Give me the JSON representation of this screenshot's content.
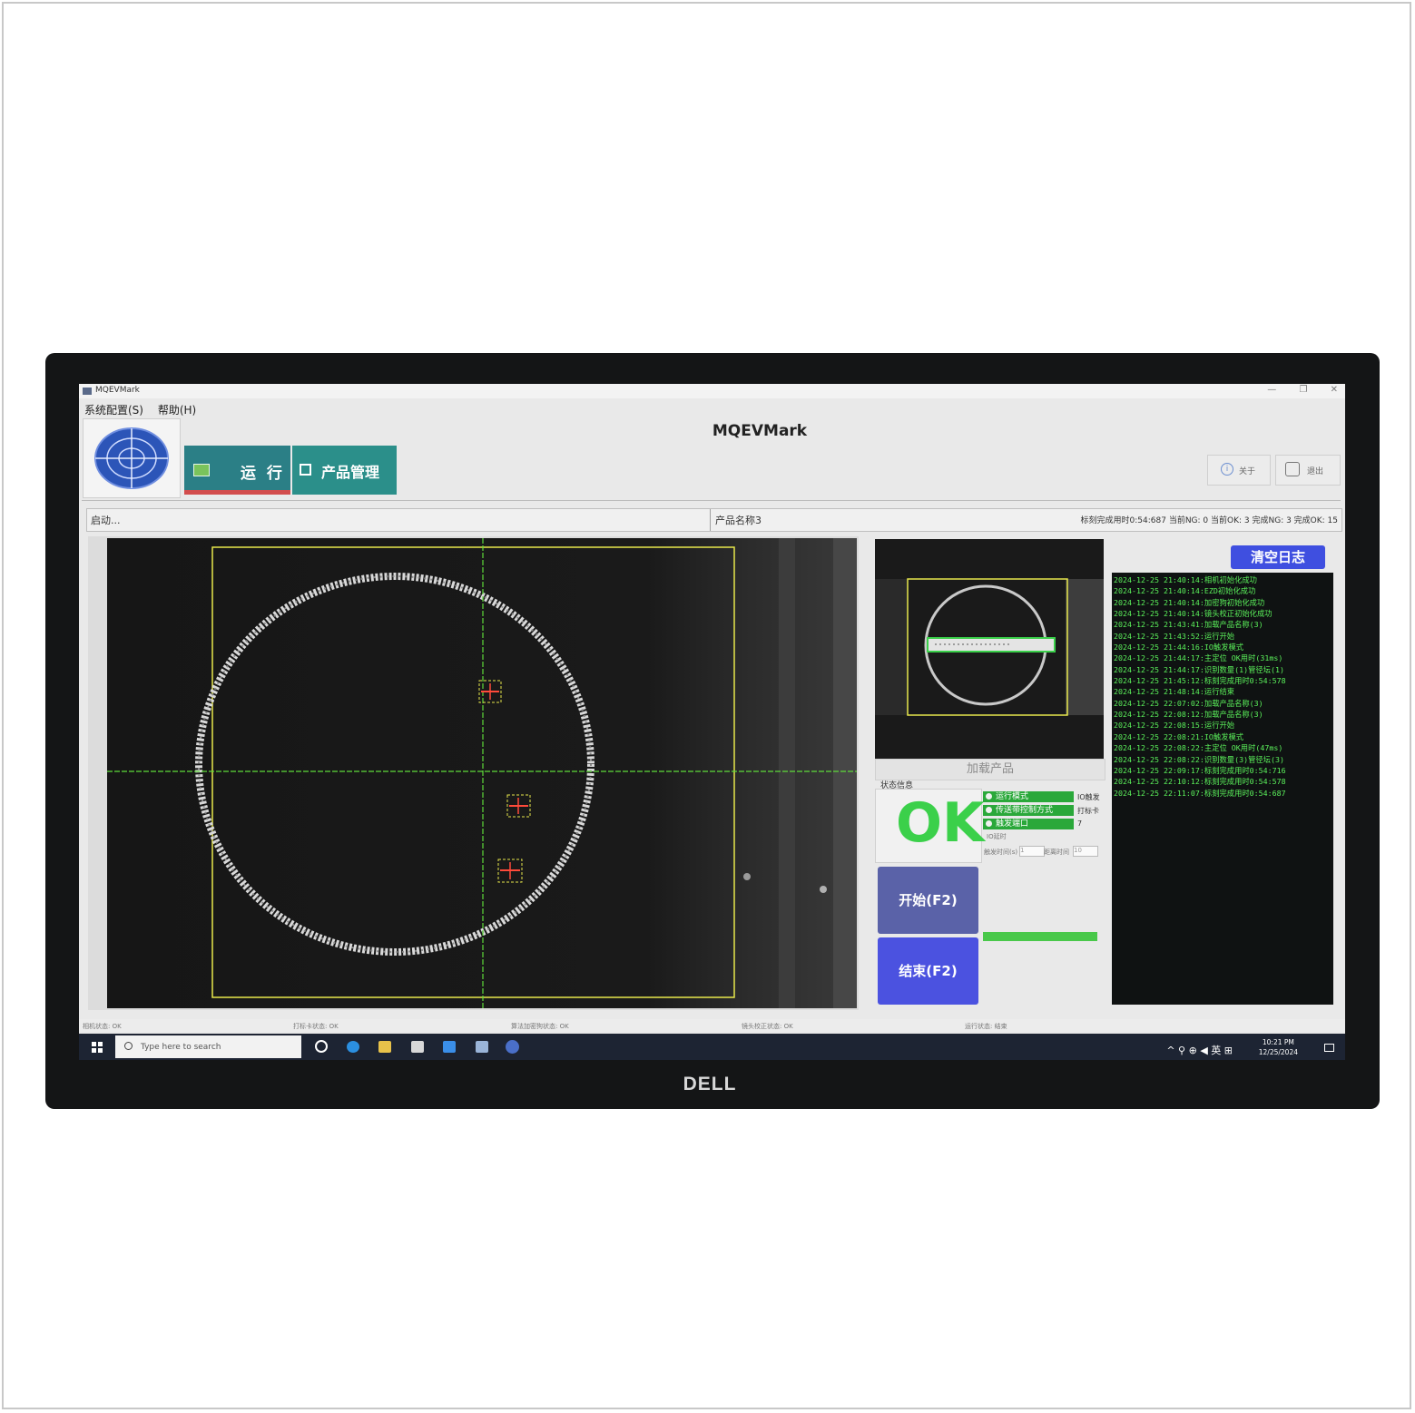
{
  "window": {
    "title": "MQEVMark",
    "controls": [
      "—",
      "❐",
      "✕"
    ]
  },
  "menu": {
    "items": [
      "系统配置(S)",
      "帮助(H)"
    ]
  },
  "app": {
    "heading": "MQEVMark"
  },
  "nav": {
    "run_label": "运 行",
    "product_label": "产品管理"
  },
  "header_buttons": {
    "about_label": "关于",
    "exit_label": "退出"
  },
  "status_strip": {
    "startup": "启动...",
    "product_name": "产品名称3",
    "stats": "标刻完成用时0:54:687  当前NG: 0  当前OK: 3  完成NG: 3  完成OK: 15"
  },
  "side": {
    "load_product_label": "加载产品",
    "state_title": "状态信息",
    "result": "OK",
    "config_rows": [
      {
        "label": "运行模式",
        "value": "IO触发"
      },
      {
        "label": "传送带控制方式",
        "value": "打标卡"
      },
      {
        "label": "触发端口",
        "value": "7"
      }
    ],
    "io_label": "IO延时",
    "delay_label": "触发时间(s)",
    "delay_value": "1",
    "distance_label": "距离时间",
    "distance_value": "10",
    "start_label": "开始(F2)",
    "end_label": "结束(F2)",
    "progress": 1.0
  },
  "log": {
    "clear_label": "清空日志",
    "lines": [
      "2024-12-25 21:40:14:相机初始化成功",
      "2024-12-25 21:40:14:EZD初始化成功",
      "2024-12-25 21:40:14:加密狗初始化成功",
      "2024-12-25 21:40:14:镜头校正初始化成功",
      "2024-12-25 21:43:41:加载产品名称(3)",
      "2024-12-25 21:43:52:运行开始",
      "2024-12-25 21:44:16:IO触发模式",
      "2024-12-25 21:44:17:主定位 OK用时(31ms)",
      "2024-12-25 21:44:17:识别数量(1)管径坛(1)",
      "2024-12-25 21:45:12:标刻完成用时0:54:578",
      "2024-12-25 21:48:14:运行结束",
      "2024-12-25 22:07:02:加载产品名称(3)",
      "2024-12-25 22:08:12:加载产品名称(3)",
      "2024-12-25 22:08:15:运行开始",
      "2024-12-25 22:08:21:IO触发模式",
      "2024-12-25 22:08:22:主定位 OK用时(47ms)",
      "2024-12-25 22:08:22:识别数量(3)管径坛(3)",
      "2024-12-25 22:09:17:标刻完成用时0:54:716",
      "2024-12-25 22:10:12:标刻完成用时0:54:578",
      "2024-12-25 22:11:07:标刻完成用时0:54:687"
    ]
  },
  "bottom_status": {
    "camera": "相机状态: OK",
    "marker": "打标卡状态: OK",
    "dongle": "算法加密狗状态: OK",
    "lens": "镜头校正状态: OK",
    "run": "运行状态: 结束"
  },
  "taskbar": {
    "search_placeholder": "Type here to search",
    "tray_text": "^ ⚲ ⊕ ◀ 英 ⊞",
    "time": "10:21 PM",
    "date": "12/25/2024"
  },
  "brand": "DELL",
  "colors": {
    "run_tab": "#2b7f86",
    "product_tab": "#2b8f8a",
    "ok_green": "#3bd04a",
    "log_text": "#5bf25b",
    "start_button": "#5a62a8",
    "end_button": "#4b52e0",
    "clear_button": "#3f4fe0"
  }
}
